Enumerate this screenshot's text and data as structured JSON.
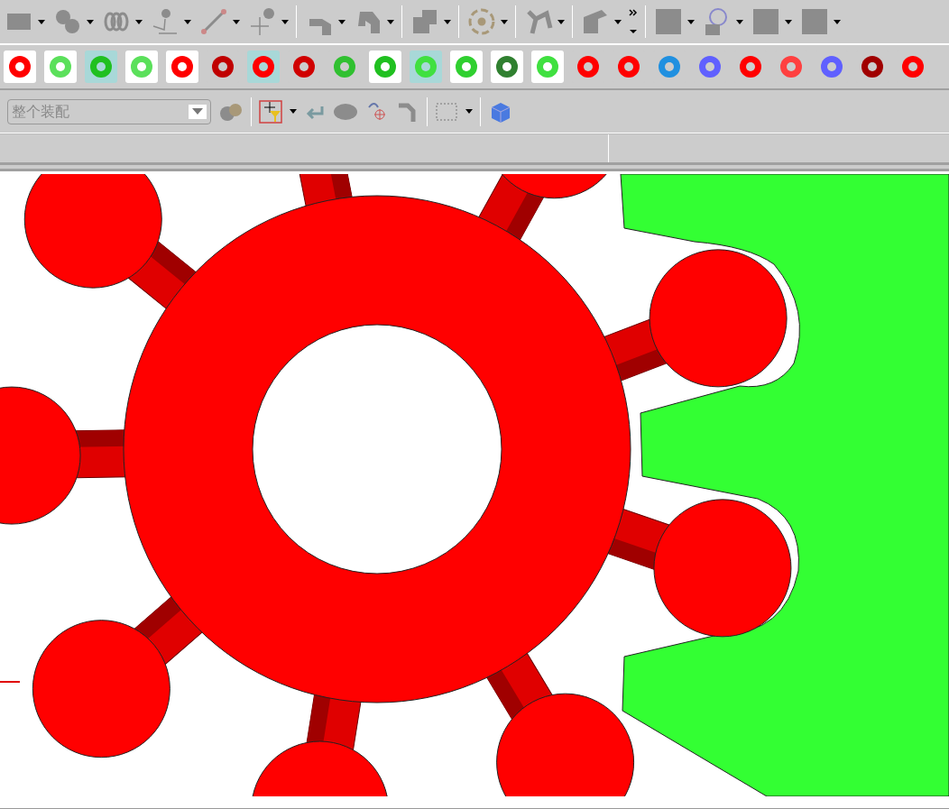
{
  "selection_filter": {
    "value": "整个装配",
    "disabled": true
  }
}
